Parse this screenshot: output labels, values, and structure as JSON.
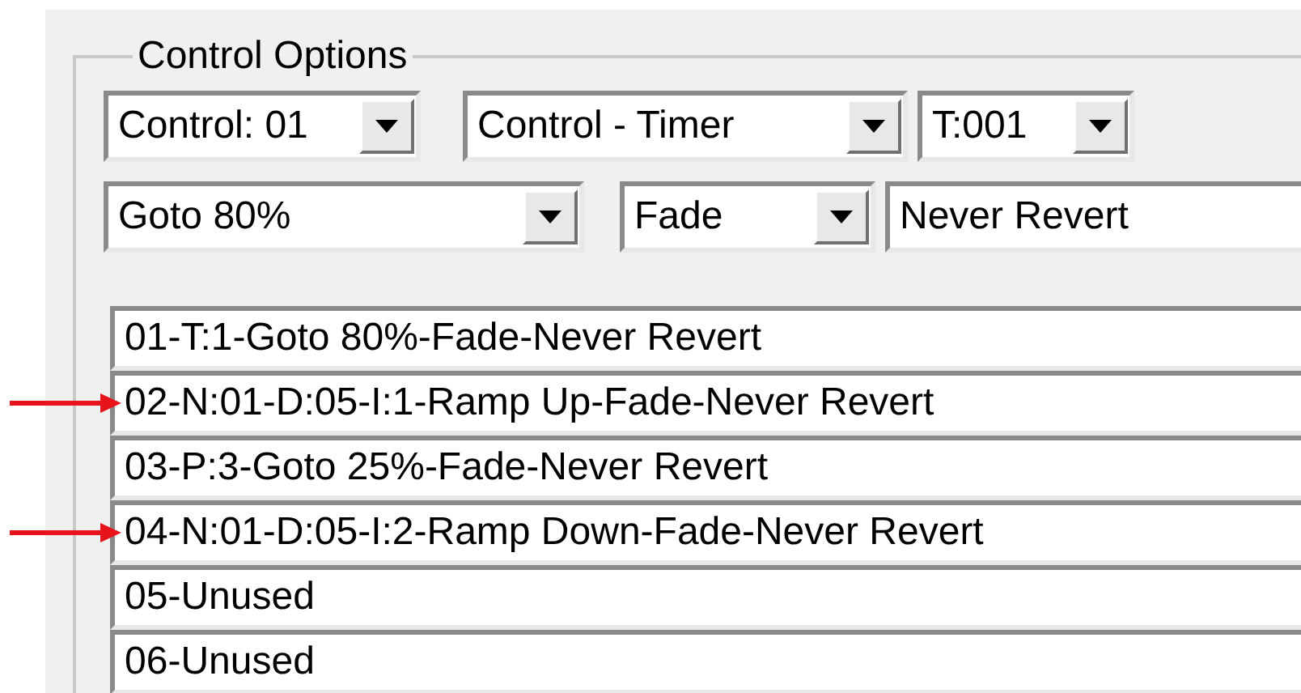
{
  "group": {
    "title": "Control Options"
  },
  "combo_rows": [
    [
      {
        "kind": "combo",
        "value": "Control: 01"
      },
      {
        "kind": "combo",
        "value": "Control - Timer"
      },
      {
        "kind": "combo",
        "value": "T:001"
      }
    ],
    [
      {
        "kind": "combo",
        "value": "Goto 80%"
      },
      {
        "kind": "combo",
        "value": "Fade"
      },
      {
        "kind": "text",
        "value": "Never Revert"
      }
    ]
  ],
  "entries": [
    {
      "text": "01-T:1-Goto 80%-Fade-Never Revert",
      "arrow": false
    },
    {
      "text": "02-N:01-D:05-I:1-Ramp Up-Fade-Never Revert",
      "arrow": true
    },
    {
      "text": "03-P:3-Goto 25%-Fade-Never Revert",
      "arrow": false
    },
    {
      "text": "04-N:01-D:05-I:2-Ramp Down-Fade-Never Revert",
      "arrow": true
    },
    {
      "text": "05-Unused",
      "arrow": false
    },
    {
      "text": "06-Unused",
      "arrow": false
    }
  ]
}
